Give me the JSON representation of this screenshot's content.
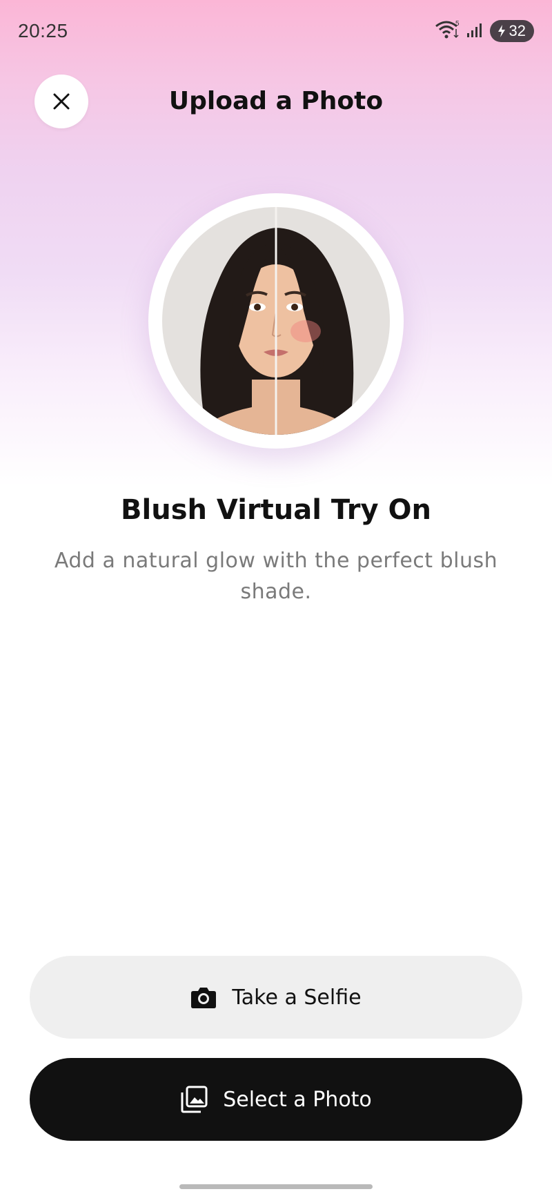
{
  "status_bar": {
    "time": "20:25",
    "battery": "32",
    "icons": [
      "wifi-icon",
      "signal-icon",
      "battery-icon"
    ]
  },
  "header": {
    "title": "Upload a Photo",
    "close_icon": "close-icon"
  },
  "hero": {
    "image_description": "split before/after portrait of a woman, right half with blush applied"
  },
  "feature": {
    "title": "Blush Virtual Try On",
    "description": "Add a natural glow with the perfect blush shade."
  },
  "actions": {
    "selfie_label": "Take a Selfie",
    "selfie_icon": "camera-icon",
    "select_label": "Select a Photo",
    "select_icon": "gallery-icon"
  },
  "colors": {
    "gradient_top": "#fbb6d6",
    "gradient_mid": "#efd2f0",
    "primary_button": "#111111",
    "secondary_button": "#efefef",
    "description_text": "#7a7a7a"
  }
}
